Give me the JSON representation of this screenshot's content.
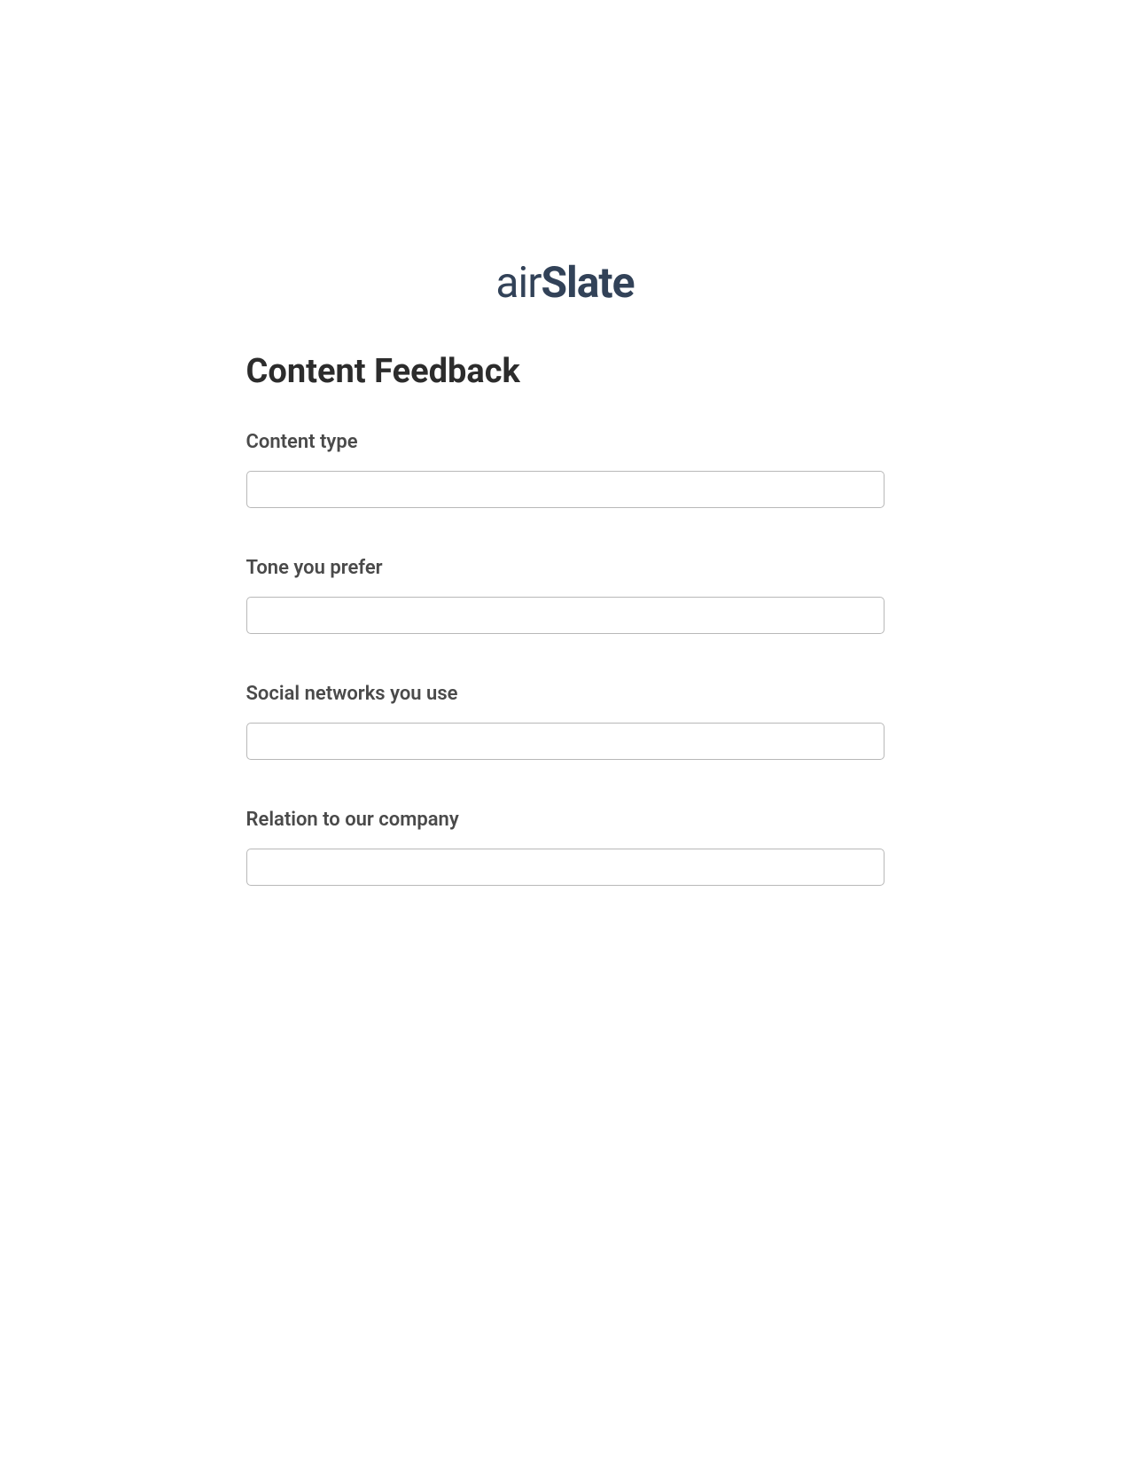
{
  "logo": {
    "prefix": "air",
    "suffix": "Slate"
  },
  "form": {
    "title": "Content Feedback",
    "fields": [
      {
        "label": "Content type",
        "value": ""
      },
      {
        "label": "Tone you prefer",
        "value": ""
      },
      {
        "label": "Social networks you use",
        "value": ""
      },
      {
        "label": "Relation to our company",
        "value": ""
      }
    ]
  }
}
